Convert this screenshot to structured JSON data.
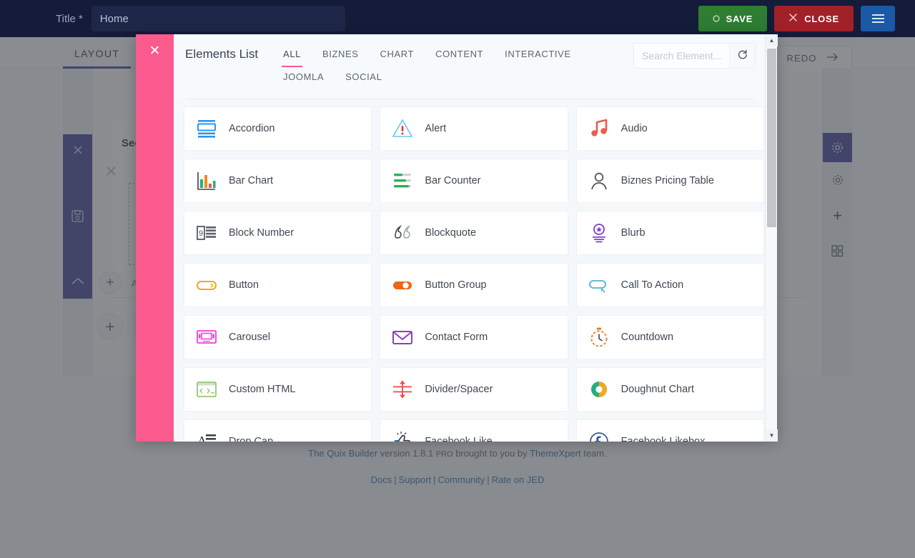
{
  "topbar": {
    "title_label": "Title *",
    "title_value": "Home",
    "title_placeholder": "Home",
    "save_label": "SAVE",
    "close_label": "CLOSE",
    "menu_icon": "hamburger-icon",
    "save_color": "#2e7d32",
    "close_color": "#a02128",
    "menu_color": "#1b58a5"
  },
  "subbar": {
    "layout_tab": "LAYOUT",
    "redo_label": "REDO",
    "redo_icon": "arrow-right-icon"
  },
  "canvas": {
    "section_title": "Section",
    "add_label": "Add Row",
    "close_icon": "close-icon",
    "save_icon": "floppy-disk-icon",
    "collapse_icon": "chevron-up-icon",
    "gear_icon": "gear-icon",
    "plus_icon": "plus-icon",
    "grid_icon": "grid-icon",
    "move_icon": "move-icon",
    "accent_color": "#3d4196"
  },
  "modal": {
    "close_icon": "close-icon",
    "accent_color": "#fa5a8d",
    "title": "Elements List",
    "tabs": [
      {
        "label": "ALL",
        "active": true
      },
      {
        "label": "BIZNES",
        "active": false
      },
      {
        "label": "CHART",
        "active": false
      },
      {
        "label": "CONTENT",
        "active": false
      },
      {
        "label": "INTERACTIVE",
        "active": false
      },
      {
        "label": "JOOMLA",
        "active": false
      },
      {
        "label": "SOCIAL",
        "active": false
      }
    ],
    "search": {
      "value": "",
      "placeholder": "Search Element..."
    },
    "refresh_icon": "refresh-icon",
    "scrollbar": {
      "up_icon": "caret-up-icon",
      "down_icon": "caret-down-icon",
      "thumb_position_pct": 4,
      "thumb_size_pct": 45
    },
    "elements": [
      {
        "label": "Accordion",
        "icon": "accordion-icon",
        "color": "#2f95e8"
      },
      {
        "label": "Alert",
        "icon": "alert-triangle-icon",
        "color": "#6dc8e8"
      },
      {
        "label": "Audio",
        "icon": "music-note-icon",
        "color": "#ef5a4c"
      },
      {
        "label": "Bar Chart",
        "icon": "bar-chart-icon",
        "color": "#27ae80"
      },
      {
        "label": "Bar Counter",
        "icon": "bar-counter-icon",
        "color": "#2eaf58"
      },
      {
        "label": "Biznes Pricing Table",
        "icon": "user-icon",
        "color": "#4a4f57"
      },
      {
        "label": "Block Number",
        "icon": "block-number-icon",
        "color": "#55595f"
      },
      {
        "label": "Blockquote",
        "icon": "quote-icon",
        "color": "#3c4149"
      },
      {
        "label": "Blurb",
        "icon": "blurb-badge-icon",
        "color": "#7d3ec4"
      },
      {
        "label": "Button",
        "icon": "button-pill-icon",
        "color": "#f5a623"
      },
      {
        "label": "Button Group",
        "icon": "button-group-icon",
        "color": "#ef6512"
      },
      {
        "label": "Call To Action",
        "icon": "call-to-action-icon",
        "color": "#49b6d6"
      },
      {
        "label": "Carousel",
        "icon": "carousel-icon",
        "color": "#ef3fd2"
      },
      {
        "label": "Contact Form",
        "icon": "envelope-icon",
        "color": "#8e3fc0"
      },
      {
        "label": "Countdown",
        "icon": "stopwatch-icon",
        "color": "#f07a1f"
      },
      {
        "label": "Custom HTML",
        "icon": "code-window-icon",
        "color": "#97c680"
      },
      {
        "label": "Divider/Spacer",
        "icon": "divider-icon",
        "color": "#ef4b4b"
      },
      {
        "label": "Doughnut Chart",
        "icon": "doughnut-chart-icon",
        "color": "#f5a623"
      },
      {
        "label": "Drop Cap",
        "icon": "drop-cap-icon",
        "color": "#2b3038"
      },
      {
        "label": "Facebook Like",
        "icon": "thumbs-up-icon",
        "color": "#2f6fb0"
      },
      {
        "label": "Facebook Likebox",
        "icon": "facebook-icon",
        "color": "#3b5998"
      }
    ],
    "partial_row": [
      {
        "label": "",
        "icon": "divider-dashed-icon",
        "color": "#30c8e0"
      },
      {
        "label": "",
        "icon": "blank-icon",
        "color": "#ffffff"
      },
      {
        "label": "",
        "icon": "two-boxes-icon",
        "color": "#f5a623"
      }
    ]
  },
  "footer": {
    "brand": "The Quix Builder",
    "version_text": " version 1.8.1 ",
    "pro": "PRO",
    "brought": " brought to you by ",
    "vendor": "ThemeXpert",
    "team": " team.",
    "links": [
      "Docs",
      "Support",
      "Community",
      "Rate on JED"
    ],
    "link_color": "#2f6fb0"
  }
}
